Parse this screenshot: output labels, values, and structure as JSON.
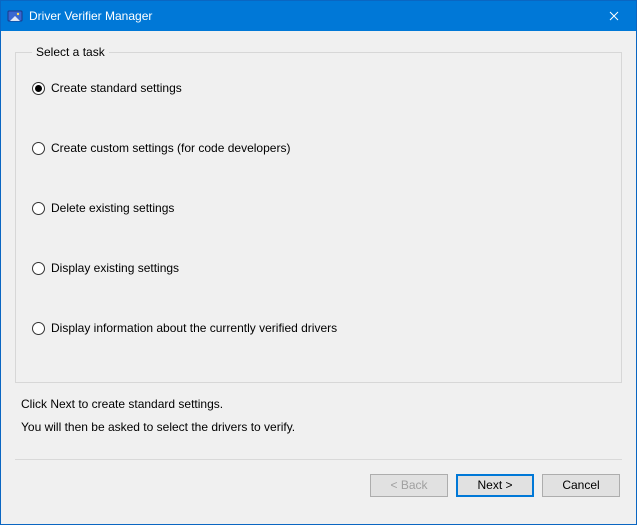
{
  "window": {
    "title": "Driver Verifier Manager"
  },
  "groupbox": {
    "legend": "Select a task"
  },
  "tasks": [
    {
      "label": "Create standard settings",
      "checked": true
    },
    {
      "label": "Create custom settings (for code developers)",
      "checked": false
    },
    {
      "label": "Delete existing settings",
      "checked": false
    },
    {
      "label": "Display existing settings",
      "checked": false
    },
    {
      "label": "Display information about the currently verified drivers",
      "checked": false
    }
  ],
  "hint": {
    "line1": "Click Next to create standard settings.",
    "line2": "You will then be asked to select the drivers to verify."
  },
  "buttons": {
    "back": "< Back",
    "next": "Next >",
    "cancel": "Cancel"
  }
}
